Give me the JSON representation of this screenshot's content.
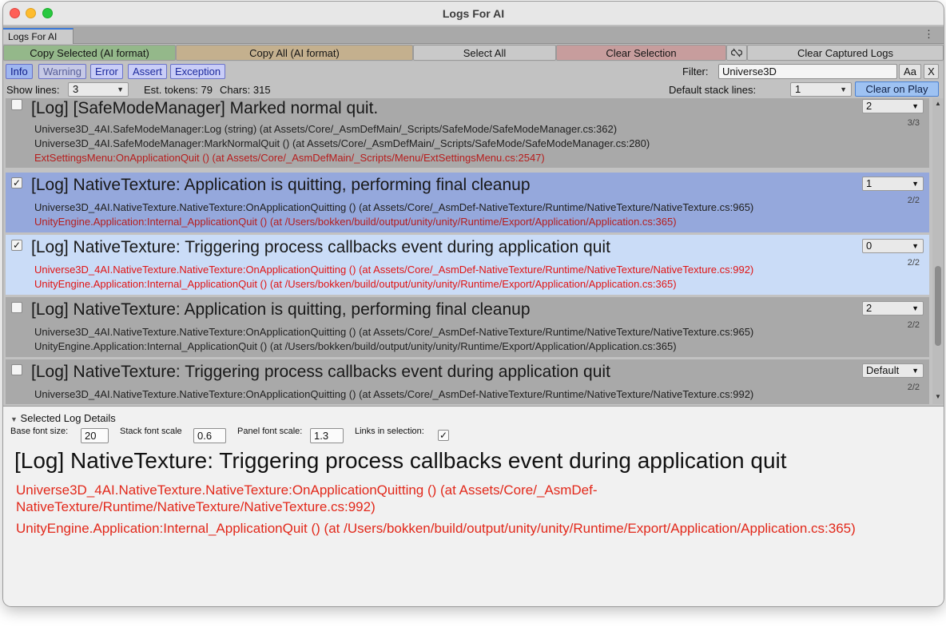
{
  "window": {
    "title": "Logs For AI"
  },
  "tab": {
    "label": "Logs For AI",
    "menu_icon": "kebab-menu-icon"
  },
  "toolbar": {
    "copy_selected": "Copy Selected (AI format)",
    "copy_all": "Copy All (AI format)",
    "select_all": "Select All",
    "clear_selection": "Clear Selection",
    "link_icon": "unlink-icon",
    "clear_captured": "Clear Captured Logs",
    "colors": {
      "copy_selected": "#94b88a",
      "copy_all": "#c4b08e",
      "select_all": "#c9c9c9",
      "clear_selection": "#c79d9d",
      "clear_captured": "#c9c9c9"
    }
  },
  "levels": [
    "Info",
    "Warning",
    "Error",
    "Assert",
    "Exception"
  ],
  "filter": {
    "label": "Filter:",
    "value": "Universe3D",
    "case_button": "Aa",
    "clear_button": "X"
  },
  "options": {
    "show_lines_label": "Show lines:",
    "show_lines_value": "3",
    "tokens_text": "Est. tokens: 79",
    "chars_text": "Chars: 315",
    "default_stack_label": "Default stack lines:",
    "default_stack_value": "1",
    "clear_on_play": "Clear on Play"
  },
  "logs": [
    {
      "checked": false,
      "title": "[Log] [SafeModeManager] Marked normal quit.",
      "lines_value": "2",
      "count": "3/3",
      "stack": [
        "Universe3D_4AI.SafeModeManager:Log (string) (at Assets/Core/_AsmDefMain/_Scripts/SafeMode/SafeModeManager.cs:362)",
        "Universe3D_4AI.SafeModeManager:MarkNormalQuit () (at Assets/Core/_AsmDefMain/_Scripts/SafeMode/SafeModeManager.cs:280)",
        "ExtSettingsMenu:OnApplicationQuit () (at Assets/Core/_AsmDefMain/_Scripts/Menu/ExtSettingsMenu.cs:2547)"
      ]
    },
    {
      "checked": true,
      "title": "[Log] NativeTexture: Application is quitting, performing final cleanup",
      "lines_value": "1",
      "count": "2/2",
      "stack": [
        "Universe3D_4AI.NativeTexture.NativeTexture:OnApplicationQuitting () (at Assets/Core/_AsmDef-NativeTexture/Runtime/NativeTexture/NativeTexture.cs:965)",
        "UnityEngine.Application:Internal_ApplicationQuit () (at /Users/bokken/build/output/unity/unity/Runtime/Export/Application/Application.cs:365)"
      ]
    },
    {
      "checked": true,
      "title": "[Log] NativeTexture: Triggering process callbacks event during application quit",
      "lines_value": "0",
      "count": "2/2",
      "stack": [
        "Universe3D_4AI.NativeTexture.NativeTexture:OnApplicationQuitting () (at Assets/Core/_AsmDef-NativeTexture/Runtime/NativeTexture/NativeTexture.cs:992)",
        "UnityEngine.Application:Internal_ApplicationQuit () (at /Users/bokken/build/output/unity/unity/Runtime/Export/Application/Application.cs:365)"
      ]
    },
    {
      "checked": false,
      "title": "[Log] NativeTexture: Application is quitting, performing final cleanup",
      "lines_value": "2",
      "count": "2/2",
      "stack": [
        "Universe3D_4AI.NativeTexture.NativeTexture:OnApplicationQuitting () (at Assets/Core/_AsmDef-NativeTexture/Runtime/NativeTexture/NativeTexture.cs:965)",
        "UnityEngine.Application:Internal_ApplicationQuit () (at /Users/bokken/build/output/unity/unity/Runtime/Export/Application/Application.cs:365)"
      ]
    },
    {
      "checked": false,
      "title": "[Log] NativeTexture: Triggering process callbacks event during application quit",
      "lines_value": "Default",
      "count": "2/2",
      "stack": [
        "Universe3D_4AI.NativeTexture.NativeTexture:OnApplicationQuitting () (at Assets/Core/_AsmDef-NativeTexture/Runtime/NativeTexture/NativeTexture.cs:992)"
      ]
    }
  ],
  "details": {
    "header": "Selected Log Details",
    "base_font_label": "Base font size:",
    "base_font_value": "20",
    "stack_scale_label": "Stack font scale",
    "stack_scale_value": "0.6",
    "panel_scale_label": "Panel font scale:",
    "panel_scale_value": "1.3",
    "links_label": "Links in selection:",
    "links_checked": true,
    "title": "[Log] NativeTexture: Triggering process callbacks event during application quit",
    "stack": [
      "Universe3D_4AI.NativeTexture.NativeTexture:OnApplicationQuitting () (at Assets/Core/_AsmDef-NativeTexture/Runtime/NativeTexture/NativeTexture.cs:992)",
      "UnityEngine.Application:Internal_ApplicationQuit () (at /Users/bokken/build/output/unity/unity/Runtime/Export/Application/Application.cs:365)"
    ]
  }
}
